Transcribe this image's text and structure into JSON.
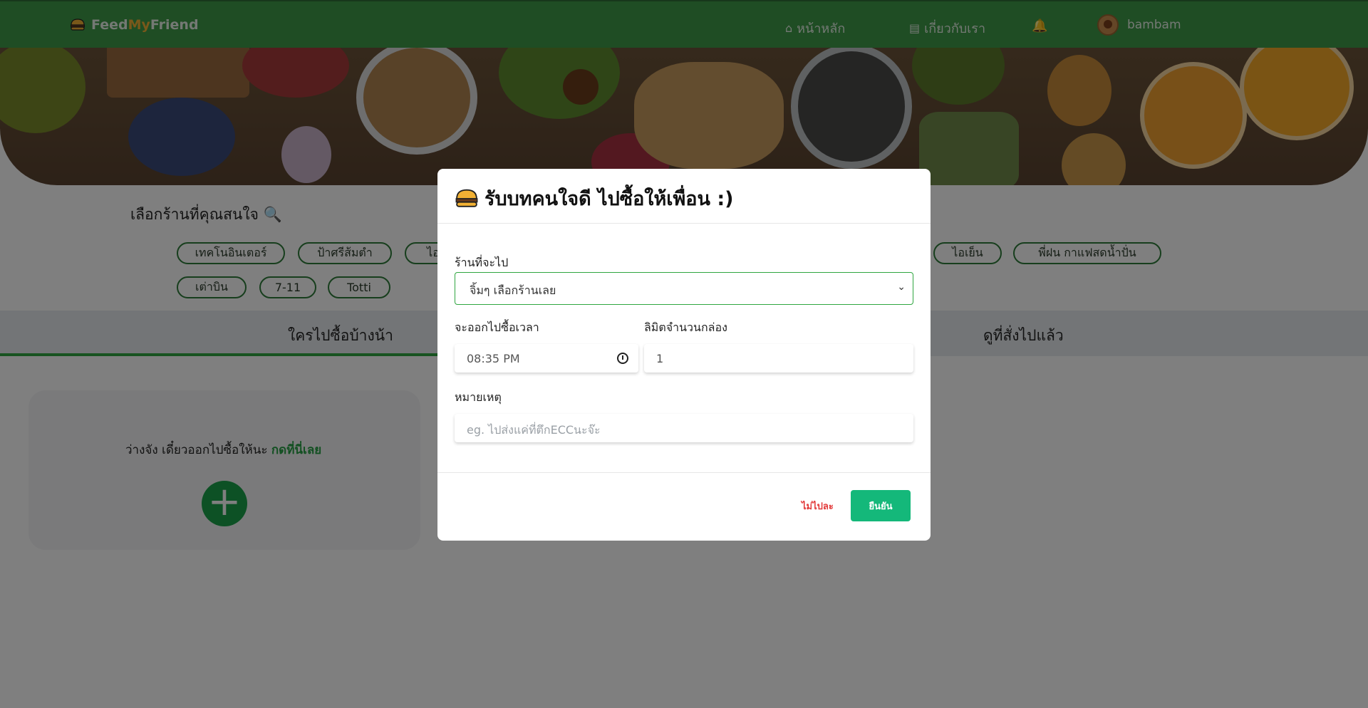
{
  "navbar": {
    "brand": {
      "part1": "Feed",
      "part2": "My",
      "part3": "Friend"
    },
    "home_label": "หน้าหลัก",
    "about_label": "เกี่ยวกับเรา",
    "username": "bambam"
  },
  "shops": {
    "title": "เลือกร้านที่คุณสนใจ 🔍",
    "chips": [
      "เทคโนอินเตอร์",
      "ป้าศรีส้มตำ",
      "ไอ",
      "ไอเย็น",
      "พี่ฝน กาแฟสดน้ำปั่น",
      "เต่าบิน",
      "7-11",
      "Totti"
    ]
  },
  "tabs": {
    "left": "ใครไปซื้อบ้างน้า",
    "right": "ดูที่สั่งไปแล้ว"
  },
  "card": {
    "text": "ว่างจัง เดี๋ยวออกไปซื้อให้นะ",
    "link": "กดที่นี่เลย",
    "plus": "+"
  },
  "modal": {
    "title": "รับบทคนใจดี ไปซื้อให้เพื่อน :)",
    "shop_label": "ร้านที่จะไป",
    "shop_select_value": "จิ้มๆ เลือกร้านเลย",
    "time_label": "จะออกไปซื้อเวลา",
    "time_value": "08:35 PM",
    "limit_label": "ลิมิตจำนวนกล่อง",
    "limit_value": "1",
    "note_label": "หมายเหตุ",
    "note_placeholder": "eg. ไปส่งแค่ที่ตึกECCนะจ๊ะ",
    "cancel_label": "ไม่ไปละ",
    "confirm_label": "ยืนยัน"
  },
  "colors": {
    "navbar": "#3f9a49",
    "accent": "#2fa640",
    "confirm": "#14b87a",
    "cancel": "#e23a3a",
    "brand_my": "#f2b134"
  }
}
